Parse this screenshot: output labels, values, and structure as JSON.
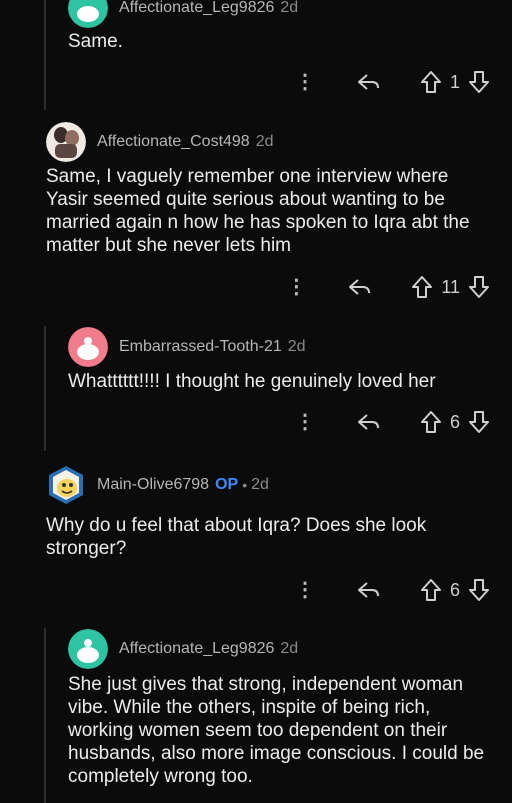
{
  "comments": [
    {
      "author": "Affectionate_Leg9826",
      "age": "2d",
      "body": "Same.",
      "votes": "1",
      "avatar": {
        "style": "snoo",
        "color": "#2ec4a3"
      }
    },
    {
      "author": "Affectionate_Cost498",
      "age": "2d",
      "body": "Same, I vaguely remember one interview where Yasir seemed quite serious about wanting to be married again n how he has spoken to Iqra abt the matter but she never lets him",
      "votes": "11",
      "avatar": {
        "style": "photo",
        "color": "#6a5a52"
      }
    },
    {
      "author": "Embarrassed-Tooth-21",
      "age": "2d",
      "body": "Whatttttt!!!! I thought he genuinely loved her",
      "votes": "6",
      "avatar": {
        "style": "snoo",
        "color": "#f07b8b"
      }
    },
    {
      "author": "Main-Olive6798",
      "op_label": "OP",
      "separator": "•",
      "age": "2d",
      "body": "Why do u feel that about Iqra? Does she look stronger?",
      "votes": "6",
      "avatar": {
        "style": "custom",
        "color": "#f4d35e"
      }
    },
    {
      "author": "Affectionate_Leg9826",
      "age": "2d",
      "body": "She just gives that strong, independent woman vibe. While the others, inspite of being rich, working women seem too dependent on their husbands, also more image conscious. I could be completely wrong too.",
      "avatar": {
        "style": "snoo",
        "color": "#2ec4a3"
      }
    }
  ],
  "icons": {
    "more": "more-icon",
    "reply": "reply-icon",
    "upvote": "upvote-icon",
    "downvote": "downvote-icon"
  },
  "more_glyph": "⋮"
}
